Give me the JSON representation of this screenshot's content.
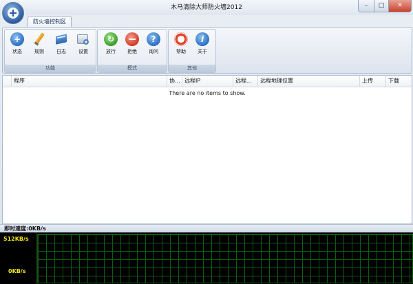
{
  "window": {
    "title": "木马清除大师防火墙2012",
    "controls": {
      "minimize": "–",
      "maximize": "□",
      "close": "✕"
    }
  },
  "ribbon": {
    "tab_label": "防火墙控制区",
    "groups": [
      {
        "label": "功能",
        "buttons": [
          {
            "label": "状态",
            "icon": "status-plus-icon"
          },
          {
            "label": "规则",
            "icon": "pencil-icon"
          },
          {
            "label": "日志",
            "icon": "log-book-icon"
          },
          {
            "label": "设置",
            "icon": "settings-icon"
          }
        ]
      },
      {
        "label": "模式",
        "buttons": [
          {
            "label": "放行",
            "icon": "allow-icon"
          },
          {
            "label": "拒绝",
            "icon": "deny-icon"
          },
          {
            "label": "询问",
            "icon": "ask-icon"
          }
        ]
      },
      {
        "label": "其他",
        "buttons": [
          {
            "label": "帮助",
            "icon": "lifebuoy-icon"
          },
          {
            "label": "关于",
            "icon": "info-icon"
          }
        ]
      }
    ]
  },
  "list": {
    "columns": [
      "程序",
      "协...",
      "远程IP",
      "远程...",
      "远程地理位置",
      "上传",
      "下载"
    ],
    "empty_text": "There are no items to show."
  },
  "speed": {
    "label": "即时速度:0KB/s",
    "y_max": "512KB/s",
    "y_min": "0KB/s"
  },
  "colors": {
    "graph_background": "#000000",
    "graph_grid": "#0a5f12",
    "axis_text": "#f3e81b"
  }
}
